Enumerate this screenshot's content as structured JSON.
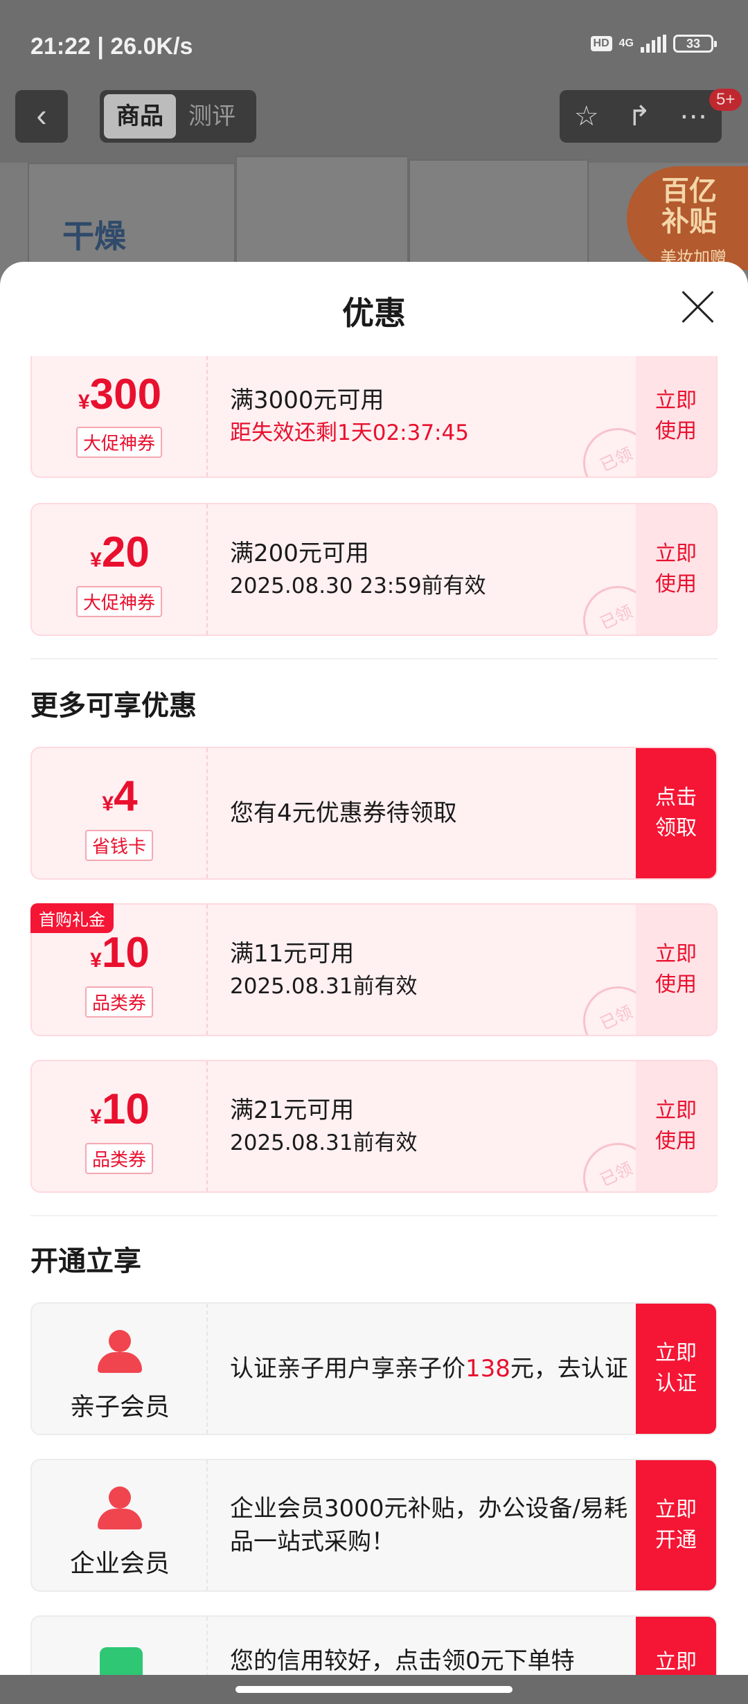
{
  "status": {
    "time": "21:22 | 26.0K/s",
    "hd": "HD",
    "network": "4G",
    "battery": "33"
  },
  "nav": {
    "tabs": [
      "商品",
      "测评"
    ],
    "badge": "5+"
  },
  "background": {
    "product_text": "干燥",
    "subsidy_line1": "百亿",
    "subsidy_line2": "补贴",
    "subsidy_line3": "美妆加赠"
  },
  "sheet": {
    "title": "优惠"
  },
  "coupons_top": [
    {
      "currency": "¥",
      "amount": "300",
      "tag": "大促神券",
      "line1": "满3000元可用",
      "line2": "距失效还剩1天02:37:45",
      "action": "立即\n使用",
      "stamp": "已领"
    },
    {
      "currency": "¥",
      "amount": "20",
      "tag": "大促神券",
      "line1": "满200元可用",
      "line2": "2025.08.30 23:59前有效",
      "action": "立即\n使用",
      "stamp": "已领"
    }
  ],
  "more_section": {
    "title": "更多可享优惠"
  },
  "coupons_more": [
    {
      "currency": "¥",
      "amount": "4",
      "tag": "省钱卡",
      "line1": "您有4元优惠券待领取",
      "action": "点击\n领取"
    },
    {
      "ribbon": "首购礼金",
      "currency": "¥",
      "amount": "10",
      "tag": "品类券",
      "line1": "满11元可用",
      "line2": "2025.08.31前有效",
      "action": "立即\n使用",
      "stamp": "已领"
    },
    {
      "currency": "¥",
      "amount": "10",
      "tag": "品类券",
      "line1": "满21元可用",
      "line2": "2025.08.31前有效",
      "action": "立即\n使用",
      "stamp": "已领"
    }
  ],
  "open_section": {
    "title": "开通立享"
  },
  "members": [
    {
      "name": "亲子会员",
      "text_before": "认证亲子用户享亲子价",
      "text_highlight": "138",
      "text_after": "元，去认证",
      "action": "立即\n认证"
    },
    {
      "name": "企业会员",
      "text": " 企业会员3000元补贴，办公设备/易耗品一站式采购！",
      "action": "立即\n开通"
    },
    {
      "text": "您的信用较好，点击领0元下单特",
      "action": "立即"
    }
  ],
  "colors": {
    "accent": "#f51534",
    "coupon_bg": "#fff0f2"
  }
}
